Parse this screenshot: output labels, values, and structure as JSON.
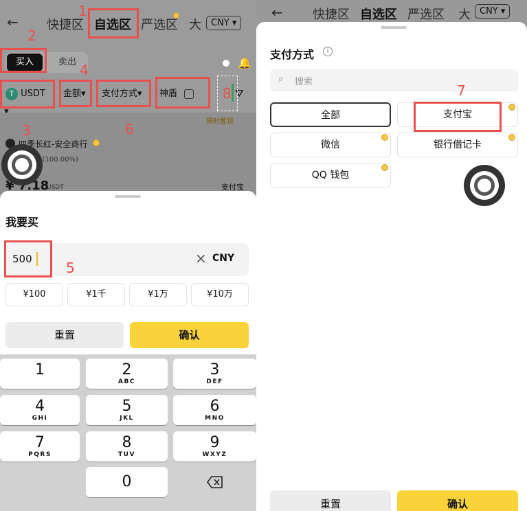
{
  "nav": {
    "back_glyph": "←",
    "tabs": [
      "快捷区",
      "自选区",
      "严选区",
      "大"
    ],
    "currency": "CNY"
  },
  "left": {
    "buy_tab": "买入",
    "sell_tab": "卖出",
    "filters": {
      "coin": "USDT",
      "amount": "金额",
      "payment": "支付方式",
      "shield": "神盾"
    },
    "promo_tag": "限时置顶",
    "merchant_name": "四季长红-安全商行",
    "merchant_stats": "0 (100.00%)",
    "price_partial": "¥ 7.18",
    "price_unit": "USDT",
    "pay_partial": "支付宝",
    "sheet_title": "我要买",
    "amount_value": "500",
    "amount_currency": "CNY",
    "quick_amounts": [
      "¥100",
      "¥1千",
      "¥1万",
      "¥10万"
    ],
    "reset": "重置",
    "confirm": "确认",
    "keys": [
      {
        "d": "1",
        "l": ""
      },
      {
        "d": "2",
        "l": "ABC"
      },
      {
        "d": "3",
        "l": "DEF"
      },
      {
        "d": "4",
        "l": "GHI"
      },
      {
        "d": "5",
        "l": "JKL"
      },
      {
        "d": "6",
        "l": "MNO"
      },
      {
        "d": "7",
        "l": "PQRS"
      },
      {
        "d": "8",
        "l": "TUV"
      },
      {
        "d": "9",
        "l": "WXYZ"
      },
      {
        "d": "0",
        "l": ""
      }
    ]
  },
  "right": {
    "sheet_title": "支付方式",
    "search_placeholder": "搜索",
    "options": [
      "全部",
      "支付宝",
      "微信",
      "银行借记卡",
      "QQ 钱包"
    ],
    "reset": "重置",
    "confirm": "确认"
  },
  "annotations": [
    "1",
    "2",
    "3",
    "4",
    "5",
    "6",
    "7",
    "8"
  ],
  "colors": {
    "accent_yellow": "#f8d33a",
    "annotation_red": "#e94f4f",
    "overlay_gray": "#9b9b9b"
  }
}
